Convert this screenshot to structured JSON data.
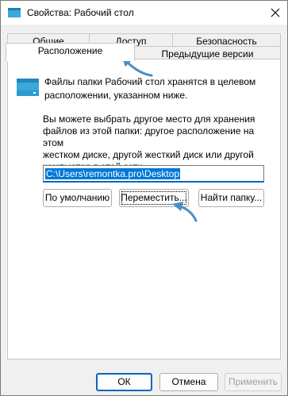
{
  "window": {
    "title": "Свойства: Рабочий стол",
    "close_glyph": "✕"
  },
  "tabs": {
    "row1": [
      "Общие",
      "Доступ",
      "Безопасность"
    ],
    "row2": [
      "Расположение",
      "Предыдущие версии"
    ],
    "active": "Расположение"
  },
  "location": {
    "description": "Файлы папки Рабочий стол хранятся в целевом\nрасположении, указанном ниже.",
    "info": "Вы можете выбрать другое место для хранения\nфайлов из этой папки: другое расположение на этом\nжестком диске, другой жесткий диск или другой\nкомпьютер в этой сети.",
    "path_value": "C:\\Users\\remontka.pro\\Desktop",
    "buttons": {
      "default": "По умолчанию",
      "move": "Переместить...",
      "find": "Найти папку..."
    }
  },
  "footer": {
    "ok": "ОК",
    "cancel": "Отмена",
    "apply": "Применить"
  },
  "colors": {
    "accent": "#0078d7",
    "arrow": "#4a8ec4",
    "folder": "#3aa8d8"
  },
  "icons": {
    "title": "folder-icon",
    "location": "folder-icon",
    "close": "close-icon",
    "annotation": "arrow-annotation"
  }
}
